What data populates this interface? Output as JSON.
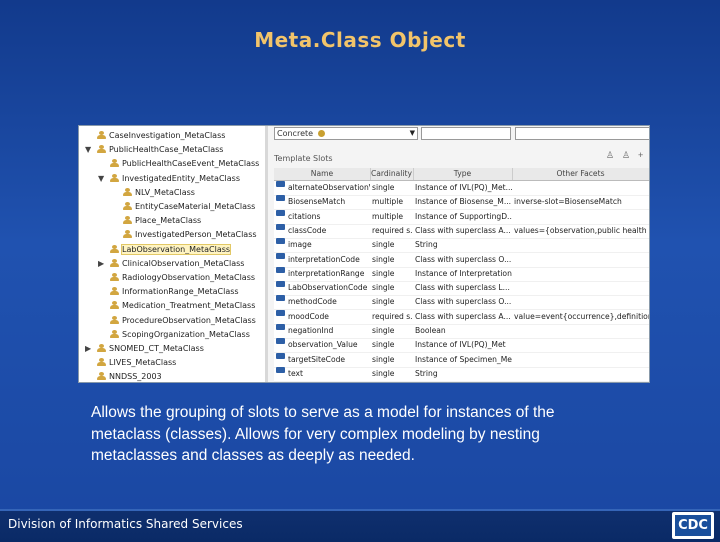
{
  "slide": {
    "title": "Meta.Class Object",
    "caption": "Allows the grouping of slots to serve as a model for instances of the metaclass (classes). Allows for very complex modeling by nesting metaclasses and classes as deeply as needed.",
    "footer": "Division of Informatics Shared Services",
    "logo_text": "CDC"
  },
  "tree": {
    "items": [
      {
        "label": "CaseInvestigation_MetaClass",
        "indent": 0,
        "arrow": ""
      },
      {
        "label": "PublicHealthCase_MetaClass",
        "indent": 0,
        "arrow": "▼"
      },
      {
        "label": "PublicHealthCaseEvent_MetaClass",
        "indent": 1,
        "arrow": ""
      },
      {
        "label": "InvestigatedEntity_MetaClass",
        "indent": 1,
        "arrow": "▼"
      },
      {
        "label": "NLV_MetaClass",
        "indent": 2,
        "arrow": ""
      },
      {
        "label": "EntityCaseMaterial_MetaClass",
        "indent": 2,
        "arrow": ""
      },
      {
        "label": "Place_MetaClass",
        "indent": 2,
        "arrow": ""
      },
      {
        "label": "InvestigatedPerson_MetaClass",
        "indent": 2,
        "arrow": ""
      },
      {
        "label": "LabObservation_MetaClass",
        "indent": 1,
        "arrow": "",
        "selected": true
      },
      {
        "label": "ClinicalObservation_MetaClass",
        "indent": 1,
        "arrow": "▶"
      },
      {
        "label": "RadiologyObservation_MetaClass",
        "indent": 1,
        "arrow": ""
      },
      {
        "label": "InformationRange_MetaClass",
        "indent": 1,
        "arrow": ""
      },
      {
        "label": "Medication_Treatment_MetaClass",
        "indent": 1,
        "arrow": ""
      },
      {
        "label": "ProcedureObservation_MetaClass",
        "indent": 1,
        "arrow": ""
      },
      {
        "label": "ScopingOrganization_MetaClass",
        "indent": 1,
        "arrow": ""
      },
      {
        "label": "SNOMED_CT_MetaClass",
        "indent": 0,
        "arrow": "▶"
      },
      {
        "label": "LIVES_MetaClass",
        "indent": 0,
        "arrow": ""
      },
      {
        "label": "NNDSS_2003",
        "indent": 0,
        "arrow": ""
      }
    ]
  },
  "editor": {
    "role_value": "Concrete",
    "template_slots_label": "Template Slots",
    "columns": [
      "Name",
      "Cardinality",
      "Type",
      "Other Facets"
    ],
    "rows": [
      {
        "name": "alternateObservationV...",
        "cardinality": "single",
        "type": "Instance of IVL(PQ)_Met...",
        "facets": ""
      },
      {
        "name": "BiosenseMatch",
        "cardinality": "multiple",
        "type": "Instance of Biosense_M...",
        "facets": "inverse-slot=BiosenseMatch"
      },
      {
        "name": "citations",
        "cardinality": "multiple",
        "type": "Instance of SupportingD...",
        "facets": ""
      },
      {
        "name": "classCode",
        "cardinality": "required s...",
        "type": "Class with superclass A...",
        "facets": "values={observation,public health case"
      },
      {
        "name": "image",
        "cardinality": "single",
        "type": "String",
        "facets": ""
      },
      {
        "name": "interpretationCode",
        "cardinality": "single",
        "type": "Class with superclass O...",
        "facets": ""
      },
      {
        "name": "interpretationRange",
        "cardinality": "single",
        "type": "Instance of Interpretation...",
        "facets": ""
      },
      {
        "name": "LabObservationCode",
        "cardinality": "single",
        "type": "Class with superclass L...",
        "facets": ""
      },
      {
        "name": "methodCode",
        "cardinality": "single",
        "type": "Class with superclass O...",
        "facets": ""
      },
      {
        "name": "moodCode",
        "cardinality": "required s...",
        "type": "Class with superclass A...",
        "facets": "value=event{occurrence},definition,"
      },
      {
        "name": "negationInd",
        "cardinality": "single",
        "type": "Boolean",
        "facets": ""
      },
      {
        "name": "observation_Value",
        "cardinality": "single",
        "type": "Instance of IVL(PQ)_Met",
        "facets": ""
      },
      {
        "name": "targetSiteCode",
        "cardinality": "single",
        "type": "Instance of Specimen_Met",
        "facets": ""
      },
      {
        "name": "text",
        "cardinality": "single",
        "type": "String",
        "facets": ""
      }
    ]
  }
}
